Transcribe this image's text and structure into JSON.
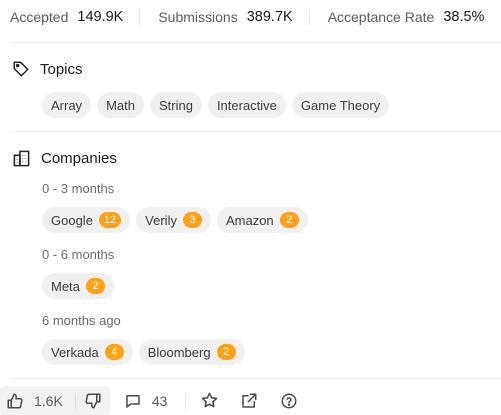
{
  "stats": {
    "accepted_label": "Accepted",
    "accepted_value": "149.9K",
    "submissions_label": "Submissions",
    "submissions_value": "389.7K",
    "acceptance_label": "Acceptance Rate",
    "acceptance_value": "38.5%"
  },
  "topics": {
    "title": "Topics",
    "tags": [
      "Array",
      "Math",
      "String",
      "Interactive",
      "Game Theory"
    ]
  },
  "companies": {
    "title": "Companies",
    "groups": [
      {
        "period": "0 - 3 months",
        "items": [
          {
            "name": "Google",
            "count": "12"
          },
          {
            "name": "Verily",
            "count": "3"
          },
          {
            "name": "Amazon",
            "count": "2"
          }
        ]
      },
      {
        "period": "0 - 6 months",
        "items": [
          {
            "name": "Meta",
            "count": "2"
          }
        ]
      },
      {
        "period": "6 months ago",
        "items": [
          {
            "name": "Verkada",
            "count": "4"
          },
          {
            "name": "Bloomberg",
            "count": "2"
          }
        ]
      }
    ]
  },
  "toolbar": {
    "likes": "1.6K",
    "comments": "43"
  },
  "colors": {
    "accent": "#ffa116",
    "tag_bg": "#f0f0f0"
  },
  "icons": [
    "tag-icon",
    "companies-icon",
    "thumbs-up-icon",
    "thumbs-down-icon",
    "comment-icon",
    "star-icon",
    "share-icon",
    "help-icon"
  ]
}
